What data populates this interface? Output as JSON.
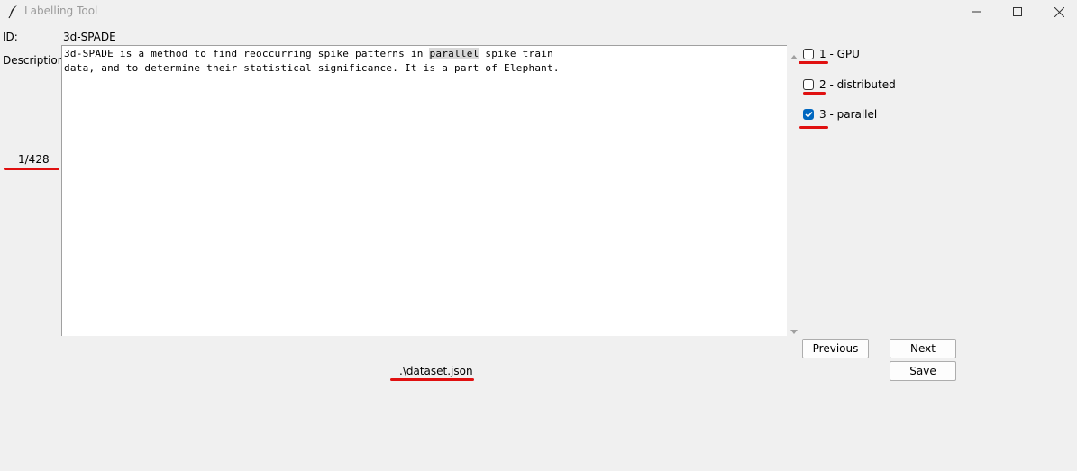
{
  "window": {
    "title": "Labelling Tool",
    "icons": {
      "app": "feather-icon",
      "minimize": "minimize-icon",
      "maximize": "maximize-icon",
      "close": "close-icon"
    }
  },
  "record": {
    "id_label": "ID:",
    "id_value": "3d-SPADE",
    "description_label": "Description:",
    "description_line1_before": "3d-SPADE is a method to find reoccurring spike patterns in ",
    "description_highlight": "parallel",
    "description_line1_after": " spike train",
    "description_line2": "data, and to determine their statistical significance. It is a part of Elephant.",
    "counter": "1/428"
  },
  "labels": [
    {
      "text": "1 - GPU",
      "checked": false
    },
    {
      "text": "2 - distributed",
      "checked": false
    },
    {
      "text": "3 - parallel",
      "checked": true
    }
  ],
  "buttons": {
    "previous": "Previous",
    "next": "Next",
    "save": "Save"
  },
  "footer": {
    "file_path": ".\\dataset.json"
  },
  "colors": {
    "annotation_underline": "#e01010",
    "checkbox_checked": "#0067c0"
  }
}
